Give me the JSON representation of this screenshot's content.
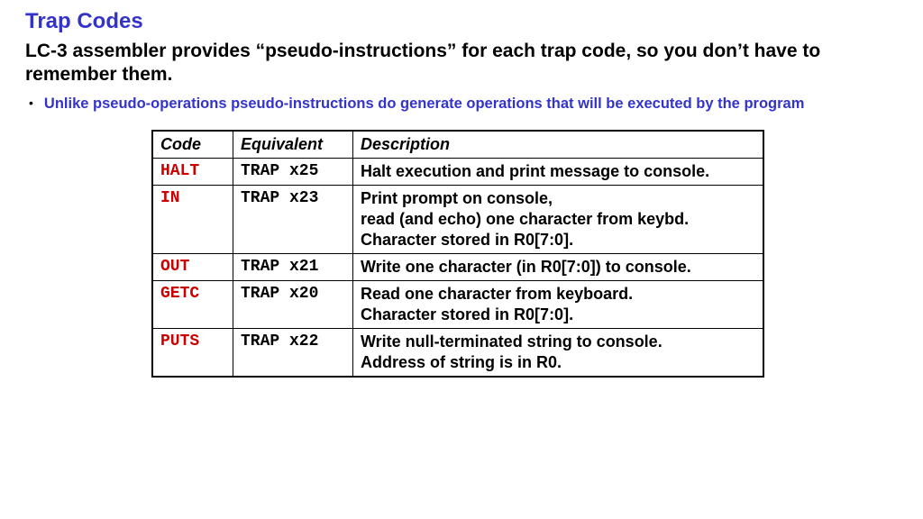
{
  "title": "Trap Codes",
  "subtitle": "LC-3 assembler provides “pseudo-instructions” for each trap code, so you don’t have to remember them.",
  "bullet": "Unlike pseudo-operations pseudo-instructions do generate operations that will be executed by the program",
  "table": {
    "headers": {
      "code": "Code",
      "equiv": "Equivalent",
      "desc": "Description"
    },
    "rows": [
      {
        "code": "HALT",
        "equiv": "TRAP x25",
        "desc": "Halt execution and print message to console."
      },
      {
        "code": "IN",
        "equiv": "TRAP x23",
        "desc": "Print prompt on console,\nread (and echo) one character from keybd.\nCharacter stored in R0[7:0]."
      },
      {
        "code": "OUT",
        "equiv": "TRAP x21",
        "desc": "Write one character (in R0[7:0]) to console."
      },
      {
        "code": "GETC",
        "equiv": "TRAP x20",
        "desc": "Read one character from keyboard.\nCharacter stored in R0[7:0]."
      },
      {
        "code": "PUTS",
        "equiv": "TRAP x22",
        "desc": "Write null-terminated string to console.\nAddress of string is in R0."
      }
    ]
  }
}
